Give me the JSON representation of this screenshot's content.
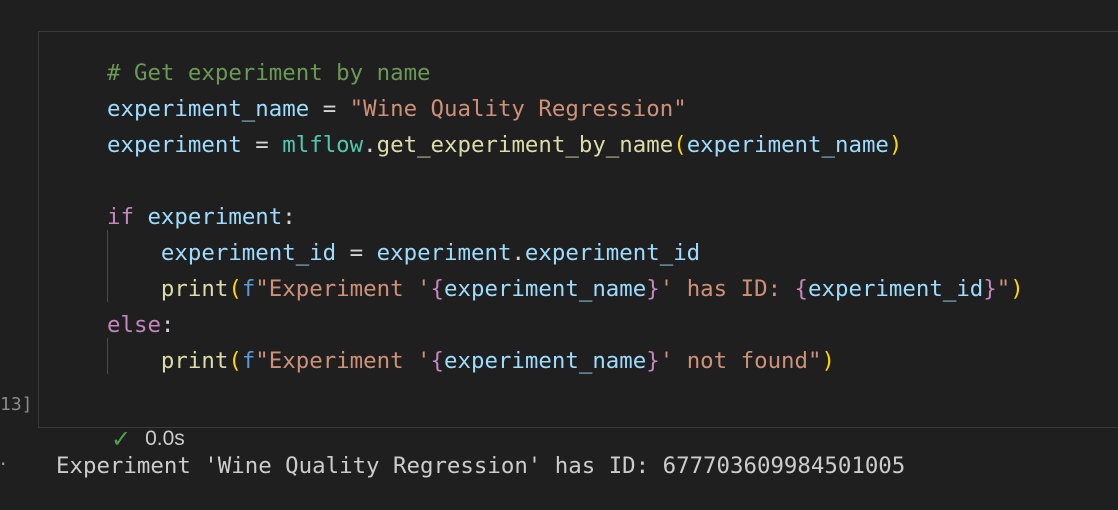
{
  "cell": {
    "execution_count": "13]",
    "status_time": "0.0s",
    "status_icon": "check-icon",
    "lines": [
      {
        "tokens": [
          {
            "t": "# Get experiment by name",
            "c": "c-comment"
          }
        ]
      },
      {
        "tokens": [
          {
            "t": "experiment_name",
            "c": "c-var"
          },
          {
            "t": " = ",
            "c": "c-op"
          },
          {
            "t": "\"Wine Quality Regression\"",
            "c": "c-str"
          }
        ]
      },
      {
        "tokens": [
          {
            "t": "experiment",
            "c": "c-var"
          },
          {
            "t": " = ",
            "c": "c-op"
          },
          {
            "t": "mlflow",
            "c": "c-mod"
          },
          {
            "t": ".",
            "c": "c-op"
          },
          {
            "t": "get_experiment_by_name",
            "c": "c-fn"
          },
          {
            "t": "(",
            "c": "c-paren"
          },
          {
            "t": "experiment_name",
            "c": "c-var"
          },
          {
            "t": ")",
            "c": "c-paren"
          }
        ]
      },
      {
        "tokens": [
          {
            "t": "",
            "c": "c-op"
          }
        ]
      },
      {
        "tokens": [
          {
            "t": "if",
            "c": "c-kw"
          },
          {
            "t": " ",
            "c": "c-op"
          },
          {
            "t": "experiment",
            "c": "c-var"
          },
          {
            "t": ":",
            "c": "c-op"
          }
        ]
      },
      {
        "tokens": [
          {
            "t": "    ",
            "c": "c-op"
          },
          {
            "t": "experiment_id",
            "c": "c-var"
          },
          {
            "t": " = ",
            "c": "c-op"
          },
          {
            "t": "experiment",
            "c": "c-var"
          },
          {
            "t": ".",
            "c": "c-op"
          },
          {
            "t": "experiment_id",
            "c": "c-var"
          }
        ]
      },
      {
        "tokens": [
          {
            "t": "    ",
            "c": "c-op"
          },
          {
            "t": "print",
            "c": "c-fn"
          },
          {
            "t": "(",
            "c": "c-paren"
          },
          {
            "t": "f",
            "c": "c-fpre"
          },
          {
            "t": "\"Experiment '",
            "c": "c-str"
          },
          {
            "t": "{",
            "c": "c-brace"
          },
          {
            "t": "experiment_name",
            "c": "c-var"
          },
          {
            "t": "}",
            "c": "c-brace"
          },
          {
            "t": "' has ID: ",
            "c": "c-str"
          },
          {
            "t": "{",
            "c": "c-brace"
          },
          {
            "t": "experiment_id",
            "c": "c-var"
          },
          {
            "t": "}",
            "c": "c-brace"
          },
          {
            "t": "\"",
            "c": "c-str"
          },
          {
            "t": ")",
            "c": "c-paren"
          }
        ]
      },
      {
        "tokens": [
          {
            "t": "else",
            "c": "c-kw"
          },
          {
            "t": ":",
            "c": "c-op"
          }
        ]
      },
      {
        "tokens": [
          {
            "t": "    ",
            "c": "c-op"
          },
          {
            "t": "print",
            "c": "c-fn"
          },
          {
            "t": "(",
            "c": "c-paren"
          },
          {
            "t": "f",
            "c": "c-fpre"
          },
          {
            "t": "\"Experiment '",
            "c": "c-str"
          },
          {
            "t": "{",
            "c": "c-brace"
          },
          {
            "t": "experiment_name",
            "c": "c-var"
          },
          {
            "t": "}",
            "c": "c-brace"
          },
          {
            "t": "' not found\"",
            "c": "c-str"
          },
          {
            "t": ")",
            "c": "c-paren"
          }
        ]
      }
    ]
  },
  "output": {
    "marker": "·",
    "text": "Experiment 'Wine Quality Regression' has ID: 677703609984501005"
  },
  "colors": {
    "background": "#1f1f1f",
    "comment": "#6a9955",
    "variable": "#9cdcfe",
    "string": "#ce9178",
    "function": "#dcdcaa",
    "keyword": "#c586c0",
    "success": "#4fa14f"
  }
}
